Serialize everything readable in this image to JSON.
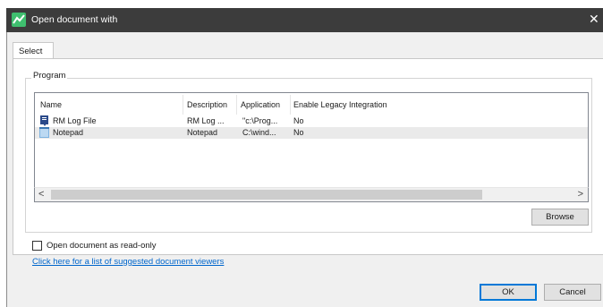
{
  "window": {
    "title": "Open document with",
    "close_glyph": "✕"
  },
  "tabs": [
    {
      "label": "Select"
    }
  ],
  "group": {
    "label": "Program"
  },
  "list": {
    "columns": [
      {
        "label": "Name"
      },
      {
        "label": "Description"
      },
      {
        "label": "Application"
      },
      {
        "label": "Enable Legacy Integration"
      }
    ],
    "rows": [
      {
        "icon": "log-file-icon",
        "name": "RM Log File",
        "description": "RM Log ...",
        "application": "\"c:\\Prog...",
        "legacy": "No",
        "selected": false
      },
      {
        "icon": "notepad-icon",
        "name": "Notepad",
        "description": "Notepad",
        "application": "C:\\wind...",
        "legacy": "No",
        "selected": true
      }
    ]
  },
  "scrollbar": {
    "left_glyph": "<",
    "right_glyph": ">"
  },
  "buttons": {
    "browse": "Browse",
    "ok": "OK",
    "cancel": "Cancel"
  },
  "options": {
    "read_only_label": "Open document as read-only",
    "read_only_checked": false
  },
  "link_text": "Click here for a list of suggested document viewers",
  "colors": {
    "titlebar": "#3c3c3c",
    "accent": "#0078d7",
    "link": "#0066cc",
    "app_icon": "#3fbf6f"
  }
}
